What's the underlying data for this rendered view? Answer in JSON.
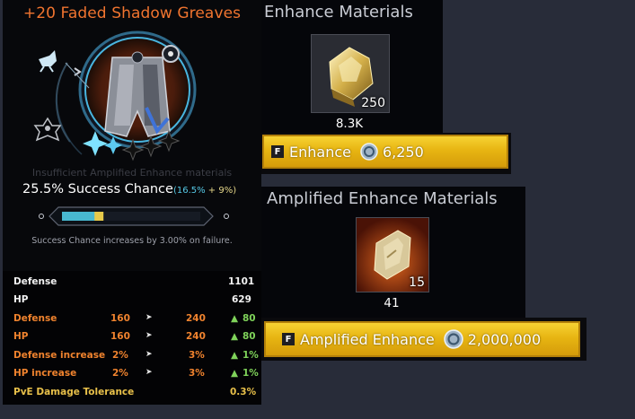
{
  "item": {
    "title": "+20 Faded Shadow Greaves",
    "insufficient_note": "Insufficient Amplified Enhance materials",
    "success_label": "25.5% Success Chance",
    "success_detail_open": "(16.5%",
    "success_detail_plus": " + 9%)",
    "progress_fraction": 0.3,
    "fail_note": "Success Chance increases by 3.00% on failure."
  },
  "stats": {
    "base": [
      {
        "name": "Defense",
        "value": "1101"
      },
      {
        "name": "HP",
        "value": "629"
      }
    ],
    "upgrades": [
      {
        "name": "Defense",
        "from": "160",
        "to": "240",
        "delta": "80"
      },
      {
        "name": "HP",
        "from": "160",
        "to": "240",
        "delta": "80"
      },
      {
        "name": "Defense increase",
        "from": "2%",
        "to": "3%",
        "delta": "1%"
      },
      {
        "name": "HP increase",
        "from": "2%",
        "to": "3%",
        "delta": "1%"
      }
    ],
    "tolerance": {
      "name": "PvE Damage Tolerance",
      "value": "0.3%"
    }
  },
  "enhance": {
    "section_title": "Enhance Materials",
    "material_count": "250",
    "material_owned": "8.3K",
    "key": "F",
    "button_label": "Enhance",
    "cost": "6,250"
  },
  "amplified": {
    "section_title": "Amplified Enhance Materials",
    "material_count": "15",
    "material_owned": "41",
    "key": "F",
    "button_label": "Amplified Enhance",
    "cost": "2,000,000"
  },
  "colors": {
    "title_orange": "#f0742f",
    "stat_orange": "#f0832e",
    "stat_green": "#7fd35a",
    "button_gold": "#e7b512",
    "progress_cyan": "#48b8d0"
  },
  "icons": [
    "greaves-item-icon",
    "bird-rank-icon",
    "spiral-rank-icon",
    "coin-icon",
    "gold-ore-icon",
    "amplify-stone-icon"
  ]
}
